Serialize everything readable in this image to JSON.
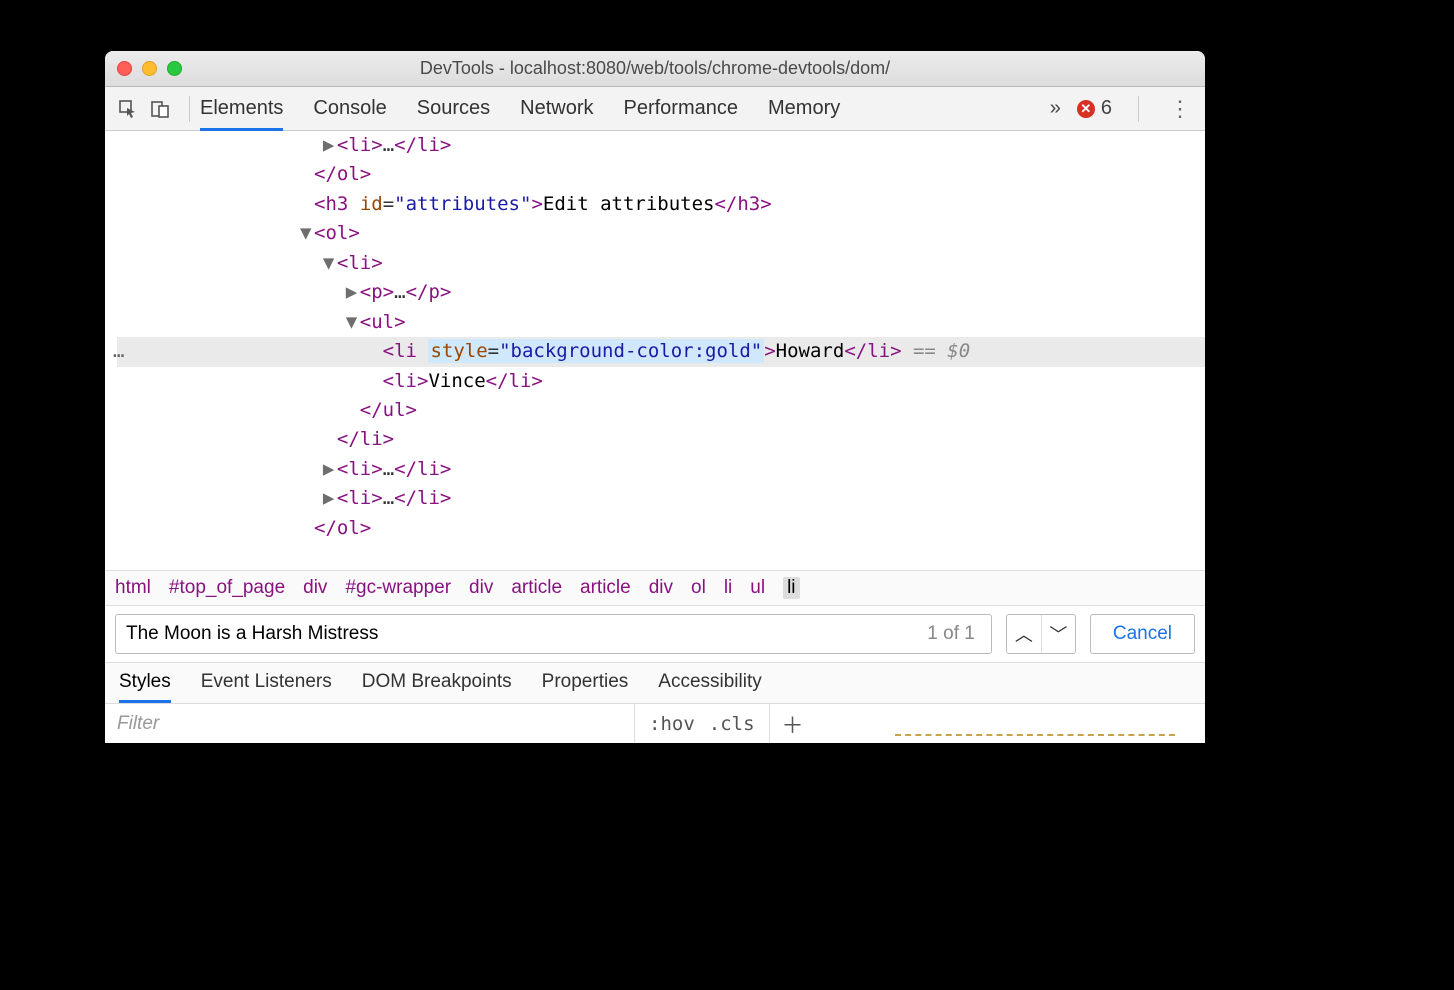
{
  "window": {
    "title": "DevTools - localhost:8080/web/tools/chrome-devtools/dom/"
  },
  "toolbar": {
    "tabs": [
      "Elements",
      "Console",
      "Sources",
      "Network",
      "Performance",
      "Memory"
    ],
    "active_tab_index": 0,
    "errors_count": "6"
  },
  "dom_tree": {
    "lines": [
      {
        "indent": 18,
        "tri": "▶",
        "html": "<li>…</li>"
      },
      {
        "indent": 16,
        "html": "</ol>"
      },
      {
        "indent": 16,
        "html": "<h3 id=\"attributes\">Edit attributes</h3>"
      },
      {
        "indent": 16,
        "tri": "▼",
        "html": "<ol>"
      },
      {
        "indent": 18,
        "tri": "▼",
        "html": "<li>"
      },
      {
        "indent": 20,
        "tri": "▶",
        "html": "<p>…</p>"
      },
      {
        "indent": 20,
        "tri": "▼",
        "html": "<ul>"
      },
      {
        "indent": 22,
        "selected": true,
        "html": "<li style=\"background-color:gold\">Howard</li>",
        "ref": " == $0"
      },
      {
        "indent": 22,
        "html": "<li>Vince</li>"
      },
      {
        "indent": 20,
        "html": "</ul>"
      },
      {
        "indent": 18,
        "html": "</li>"
      },
      {
        "indent": 18,
        "tri": "▶",
        "html": "<li>…</li>"
      },
      {
        "indent": 18,
        "tri": "▶",
        "html": "<li>…</li>"
      },
      {
        "indent": 16,
        "html": "</ol>"
      }
    ]
  },
  "breadcrumb": [
    "html",
    "#top_of_page",
    "div",
    "#gc-wrapper",
    "div",
    "article",
    "article",
    "div",
    "ol",
    "li",
    "ul",
    "li"
  ],
  "breadcrumb_selected_index": 11,
  "search": {
    "value": "The Moon is a Harsh Mistress",
    "count": "1 of 1",
    "cancel": "Cancel"
  },
  "subtabs": [
    "Styles",
    "Event Listeners",
    "DOM Breakpoints",
    "Properties",
    "Accessibility"
  ],
  "subtab_active_index": 0,
  "filter": {
    "placeholder": "Filter",
    "hov": ":hov",
    "cls": ".cls"
  }
}
